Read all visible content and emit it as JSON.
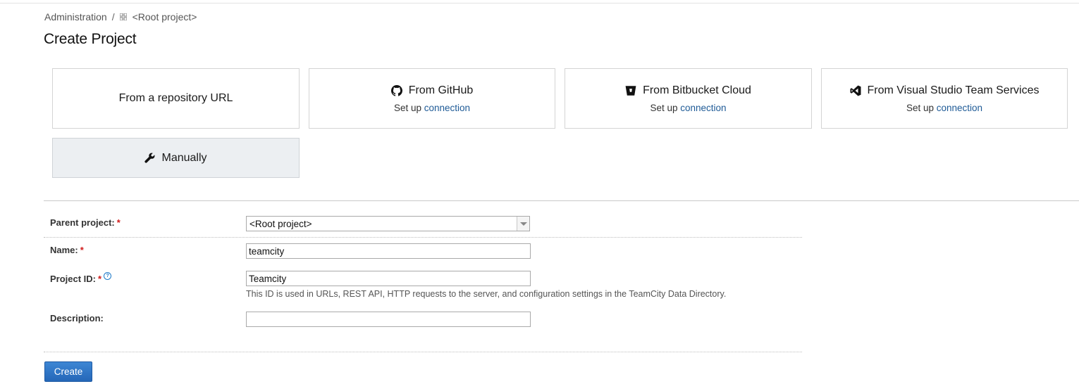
{
  "breadcrumb": {
    "root": "Administration",
    "separator": "/",
    "current": "<Root project>"
  },
  "page_title": "Create Project",
  "options": {
    "repo_url": {
      "title": "From a repository URL"
    },
    "github": {
      "title": "From GitHub",
      "setup_text": "Set up",
      "link": "connection"
    },
    "bitbucket": {
      "title": "From Bitbucket Cloud",
      "setup_text": "Set up",
      "link": "connection"
    },
    "vsts": {
      "title": "From Visual Studio Team Services",
      "setup_text": "Set up",
      "link": "connection"
    },
    "manual": {
      "title": "Manually"
    }
  },
  "form": {
    "parent_label": "Parent project:",
    "parent_value": "<Root project>",
    "name_label": "Name:",
    "name_value": "teamcity",
    "id_label": "Project ID:",
    "id_value": "Teamcity",
    "id_note": "This ID is used in URLs, REST API, HTTP requests to the server, and configuration settings in the TeamCity Data Directory.",
    "description_label": "Description:",
    "description_value": "",
    "required_mark": "*",
    "help_glyph": "?"
  },
  "create_label": "Create",
  "colors": {
    "link": "#1e5a96",
    "required": "#d01b1b",
    "button": "#2f74c6",
    "selected_card": "#eceff2"
  }
}
